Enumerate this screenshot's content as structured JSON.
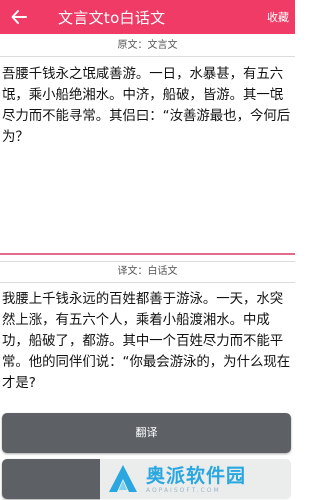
{
  "appbar": {
    "title": "文言文to白话文",
    "action_label": "收藏"
  },
  "source": {
    "header": "原文：文言文",
    "text": "吾腰千钱永之氓咸善游。一日，水暴甚，有五六氓，乘小船绝湘水。中济，船破，皆游。其一氓尽力而不能寻常。其侣曰：“汝善游最也，今何后为？"
  },
  "translation": {
    "header": "译文：白话文",
    "text": "我腰上千钱永远的百姓都善于游泳。一天，水突然上涨，有五六个人，乘着小船渡湘水。中成功，船破了，都游。其中一个百姓尽力而不能平常。他的同伴们说：“你最会游泳的，为什么现在才是?"
  },
  "buttons": {
    "translate_label": "翻译"
  },
  "watermark": {
    "name": "奥派软件园",
    "sub": "AOPAISOFT.COM"
  },
  "colors": {
    "appbar": "#ef3b66",
    "button": "#5d6166",
    "accent_line": "#e46a8a",
    "watermark_text": "#2aa7e0"
  }
}
